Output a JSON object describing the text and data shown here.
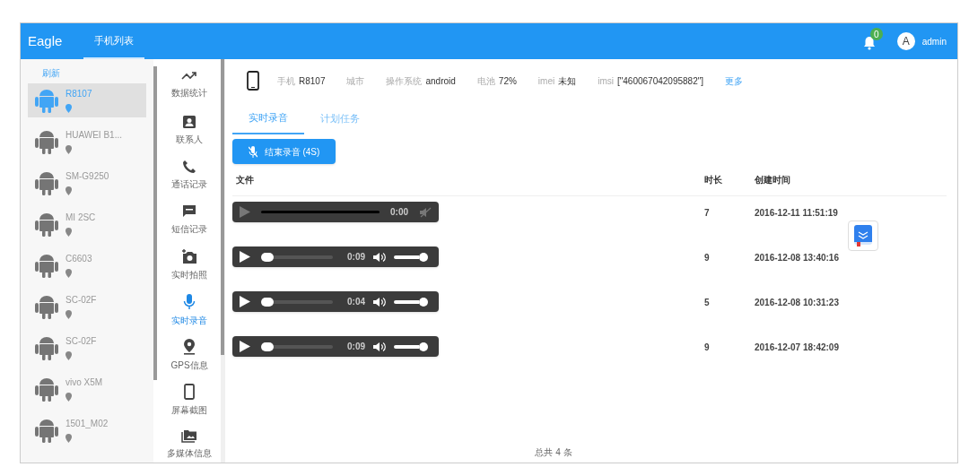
{
  "header": {
    "brand": "Eagle",
    "nav": [
      {
        "label": "手机列表",
        "selected": true
      }
    ],
    "notifications": {
      "count": "0"
    },
    "user": {
      "avatar": "A",
      "name": "admin"
    }
  },
  "phone_list": {
    "refresh": "刷新",
    "items": [
      {
        "name": "R8107",
        "selected": true
      },
      {
        "name": "HUAWEI B1...",
        "selected": false
      },
      {
        "name": "SM-G9250",
        "selected": false
      },
      {
        "name": "MI 2SC",
        "selected": false
      },
      {
        "name": "C6603",
        "selected": false
      },
      {
        "name": "SC-02F",
        "selected": false
      },
      {
        "name": "SC-02F",
        "selected": false
      },
      {
        "name": "vivo X5M",
        "selected": false
      },
      {
        "name": "1501_M02",
        "selected": false
      }
    ]
  },
  "functions": [
    {
      "kind": "stats",
      "label": "数据统计",
      "selected": false
    },
    {
      "kind": "contacts",
      "label": "联系人",
      "selected": false
    },
    {
      "kind": "calls",
      "label": "通话记录",
      "selected": false
    },
    {
      "kind": "sms",
      "label": "短信记录",
      "selected": false
    },
    {
      "kind": "camera",
      "label": "实时拍照",
      "selected": false
    },
    {
      "kind": "mic",
      "label": "实时录音",
      "selected": true
    },
    {
      "kind": "gps",
      "label": "GPS信息",
      "selected": false
    },
    {
      "kind": "screen",
      "label": "屏幕截图",
      "selected": false
    },
    {
      "kind": "media",
      "label": "多媒体信息",
      "selected": false
    }
  ],
  "device_info": [
    {
      "label": "手机",
      "value": "R8107"
    },
    {
      "label": "城市"
    },
    {
      "label": "操作系统",
      "value": "android"
    },
    {
      "label": "电池",
      "value": "72%"
    },
    {
      "label": "imei",
      "value": "未知"
    },
    {
      "label": "imsi",
      "value": "[\"460067042095882\"]"
    }
  ],
  "more_link": "更多",
  "tabs": [
    {
      "label": "实时录音",
      "selected": true
    },
    {
      "label": "计划任务",
      "selected": false
    }
  ],
  "stop_button": "结束录音 (4S)",
  "table": {
    "columns": [
      "文件",
      "时长",
      "创建时间"
    ],
    "rows": [
      {
        "player": {
          "kind": "unloaded",
          "time": "0:00"
        },
        "duration": "7",
        "created": "2016-12-11 11:51:19"
      },
      {
        "player": {
          "kind": "ready",
          "time": "0:09",
          "volume": {
            "level": 1
          }
        },
        "duration": "9",
        "created": "2016-12-08 13:40:16"
      },
      {
        "player": {
          "kind": "ready",
          "time": "0:04",
          "volume": {
            "level": 1
          }
        },
        "duration": "5",
        "created": "2016-12-08 10:31:23"
      },
      {
        "player": {
          "kind": "ready",
          "time": "0:09",
          "volume": {
            "level": 1
          }
        },
        "duration": "9",
        "created": "2016-12-07 18:42:09"
      }
    ]
  },
  "footer": "总共 4 条"
}
